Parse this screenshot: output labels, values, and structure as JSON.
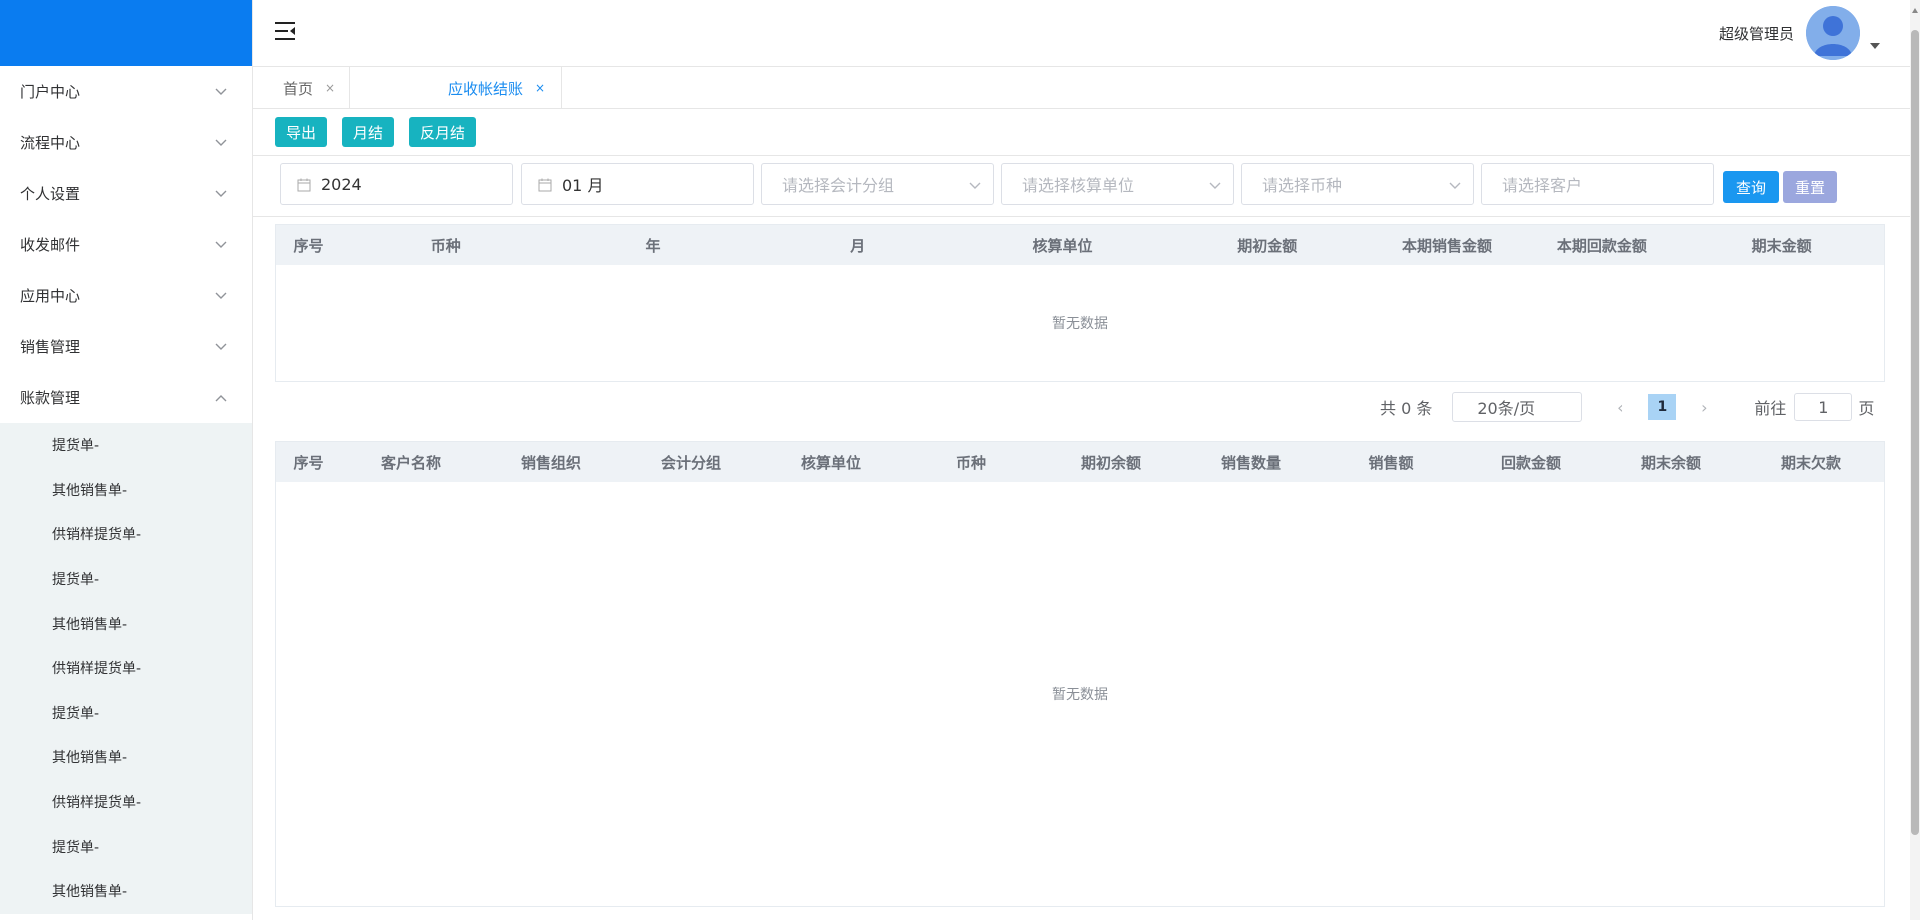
{
  "sidebar": {
    "menus": [
      {
        "label": "门户中心",
        "expanded": false
      },
      {
        "label": "流程中心",
        "expanded": false
      },
      {
        "label": "个人设置",
        "expanded": false
      },
      {
        "label": "收发邮件",
        "expanded": false
      },
      {
        "label": "应用中心",
        "expanded": false
      },
      {
        "label": "销售管理",
        "expanded": false
      },
      {
        "label": "账款管理",
        "expanded": true
      }
    ],
    "subitems": [
      "提货单-",
      "其他销售单-",
      "供销样提货单-",
      "提货单-",
      "其他销售单-",
      "供销样提货单-",
      "提货单-",
      "其他销售单-",
      "供销样提货单-",
      "提货单-",
      "其他销售单-"
    ]
  },
  "header": {
    "username": "超级管理员",
    "icons": {
      "menu": "menu-fold-icon",
      "avatar": "user-avatar-icon",
      "caret": "caret-down-icon"
    }
  },
  "tabs": [
    {
      "label": "首页",
      "close": "×"
    },
    {
      "label": "应收帐结账",
      "close": "×",
      "active": true
    }
  ],
  "toolbar": {
    "export": "导出",
    "month_close": "月结",
    "reverse_close": "反月结"
  },
  "filters": {
    "year": "2024",
    "month": "01 月",
    "group_placeholder": "请选择会计分组",
    "unit_placeholder": "请选择核算单位",
    "currency_placeholder": "请选择币种",
    "customer_placeholder": "请选择客户",
    "query": "查询",
    "reset": "重置"
  },
  "table1": {
    "columns": [
      "序号",
      "币种",
      "年",
      "月",
      "核算单位",
      "期初金额",
      "本期销售金额",
      "本期回款金额",
      "期末金额"
    ],
    "empty": "暂无数据"
  },
  "pagination": {
    "total": "共 0 条",
    "page_size": "20条/页",
    "current": "1",
    "goto_label": "前往",
    "goto_value": "1",
    "page_word": "页"
  },
  "table2": {
    "columns": [
      "序号",
      "客户名称",
      "销售组织",
      "会计分组",
      "核算单位",
      "币种",
      "期初余额",
      "销售数量",
      "销售额",
      "回款金额",
      "期末余额",
      "期末欠款"
    ],
    "empty": "暂无数据"
  },
  "colors": {
    "brand": "#0a7cf0",
    "teal_button": "#17b3c0",
    "query_button": "#1a97f0",
    "reset_button": "#9ba7de",
    "active_tab": "#1a8cf0"
  }
}
